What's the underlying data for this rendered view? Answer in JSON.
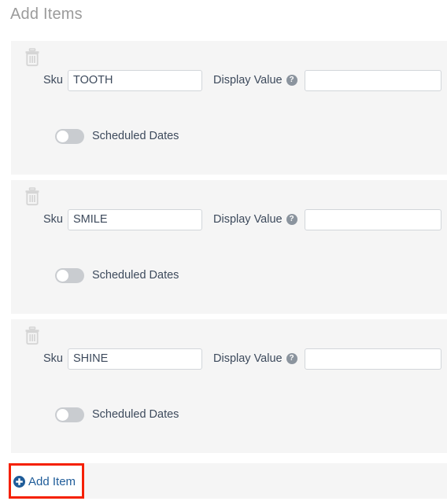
{
  "header": {
    "title": "Add Items"
  },
  "labels": {
    "sku": "Sku",
    "display_value": "Display Value",
    "help_glyph": "?",
    "scheduled_dates": "Scheduled Dates"
  },
  "icons": {
    "trash": "trash-icon",
    "help": "help-circle-icon",
    "plus": "plus-circle-icon",
    "toggle": "toggle-switch-off"
  },
  "items": [
    {
      "sku_value": "TOOTH",
      "sku_placeholder": "",
      "display_value": "",
      "display_placeholder": "",
      "scheduled_dates_on": false
    },
    {
      "sku_value": "SMILE",
      "sku_placeholder": "",
      "display_value": "",
      "display_placeholder": "",
      "scheduled_dates_on": false
    },
    {
      "sku_value": "SHINE",
      "sku_placeholder": "",
      "display_value": "",
      "display_placeholder": "",
      "scheduled_dates_on": false
    }
  ],
  "footer": {
    "add_item_label": "Add Item"
  },
  "colors": {
    "card_background": "#f5f5f5",
    "page_background": "#ffffff",
    "title_text": "#9b9b9b",
    "label_text": "#3d4a5c",
    "input_border": "#d2d6da",
    "toggle_track": "#c9ccd0",
    "toggle_knob": "#ffffff",
    "link_blue": "#1f5c99",
    "annotation_red": "#f52000",
    "help_icon_gray": "#8b949e",
    "trash_icon_gray": "#d5d5d5"
  }
}
